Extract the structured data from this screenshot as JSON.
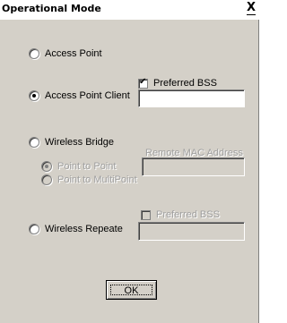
{
  "window": {
    "title": "Operational Mode",
    "close_glyph": "X"
  },
  "modes": {
    "access_point": {
      "label": "Access Point",
      "selected": false
    },
    "access_point_client": {
      "label": "Access Point Client",
      "selected": true,
      "preferred_bss_label": "Preferred BSS",
      "preferred_bss_checked": true,
      "preferred_bss_value": ""
    },
    "wireless_bridge": {
      "label": "Wireless Bridge",
      "selected": false,
      "remote_mac_label": "Remote MAC Address",
      "remote_mac_value": "",
      "sub_options": [
        {
          "label": "Point to Point",
          "selected": true,
          "enabled": false
        },
        {
          "label": "Point to MultiPoint",
          "selected": false,
          "enabled": false
        }
      ]
    },
    "wireless_repeater": {
      "label": "Wireless Repeate",
      "selected": false,
      "preferred_bss_label": "Preferred BSS",
      "preferred_bss_checked": false,
      "preferred_bss_value": ""
    }
  },
  "buttons": {
    "ok_label": "OK"
  },
  "icons": {
    "close": "close-icon",
    "checkmark": "checkmark-icon"
  },
  "colors": {
    "dialog_face": "#d4d0c8",
    "disabled_text": "#a0a0a0"
  }
}
